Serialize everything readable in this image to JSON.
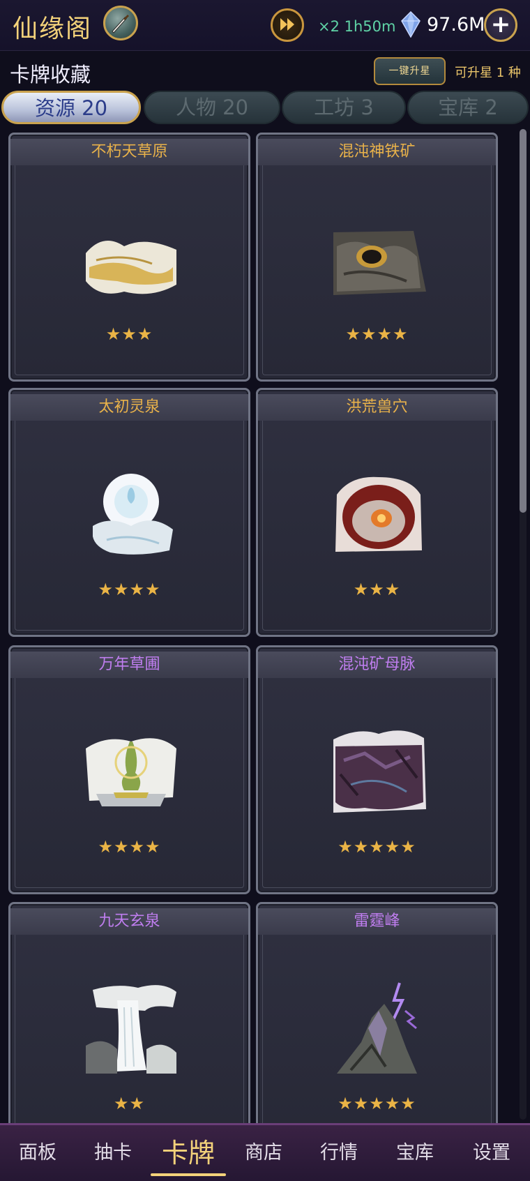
{
  "header": {
    "app_title": "仙缘阁",
    "speed_text": "×2 1h50m",
    "gem_amount": "97.6M",
    "plus_label": "+"
  },
  "collection": {
    "title": "卡牌收藏",
    "upgrade_button": "一键升星",
    "upgrade_hint": "可升星 1 种"
  },
  "tabs": [
    {
      "label": "资源 20",
      "active": true
    },
    {
      "label": "人物 20",
      "active": false
    },
    {
      "label": "工坊 3",
      "active": false
    },
    {
      "label": "宝库 2",
      "active": false
    }
  ],
  "cards": [
    {
      "name": "不朽天草原",
      "stars": "★★★",
      "rarity": "gold",
      "art": "golden-grassland"
    },
    {
      "name": "混沌神铁矿",
      "stars": "★★★★",
      "rarity": "gold",
      "art": "chaos-iron-ore"
    },
    {
      "name": "太初灵泉",
      "stars": "★★★★",
      "rarity": "gold",
      "art": "spirit-spring"
    },
    {
      "name": "洪荒兽穴",
      "stars": "★★★",
      "rarity": "gold",
      "art": "beast-cave"
    },
    {
      "name": "万年草圃",
      "stars": "★★★★",
      "rarity": "purple",
      "art": "herb-garden"
    },
    {
      "name": "混沌矿母脉",
      "stars": "★★★★★",
      "rarity": "purple",
      "art": "chaos-ore-vein"
    },
    {
      "name": "九天玄泉",
      "stars": "★★",
      "rarity": "purple",
      "art": "waterfall"
    },
    {
      "name": "雷霆峰",
      "stars": "★★★★★",
      "rarity": "purple",
      "art": "thunder-peak"
    }
  ],
  "nav": [
    {
      "label": "面板"
    },
    {
      "label": "抽卡"
    },
    {
      "label": "卡牌",
      "active": true
    },
    {
      "label": "商店"
    },
    {
      "label": "行情"
    },
    {
      "label": "宝库"
    },
    {
      "label": "设置"
    }
  ],
  "colors": {
    "gold_title": "#e9b24a",
    "purple_title": "#c07ef0",
    "star": "#eab446",
    "speed_text": "#5fd3a6"
  }
}
